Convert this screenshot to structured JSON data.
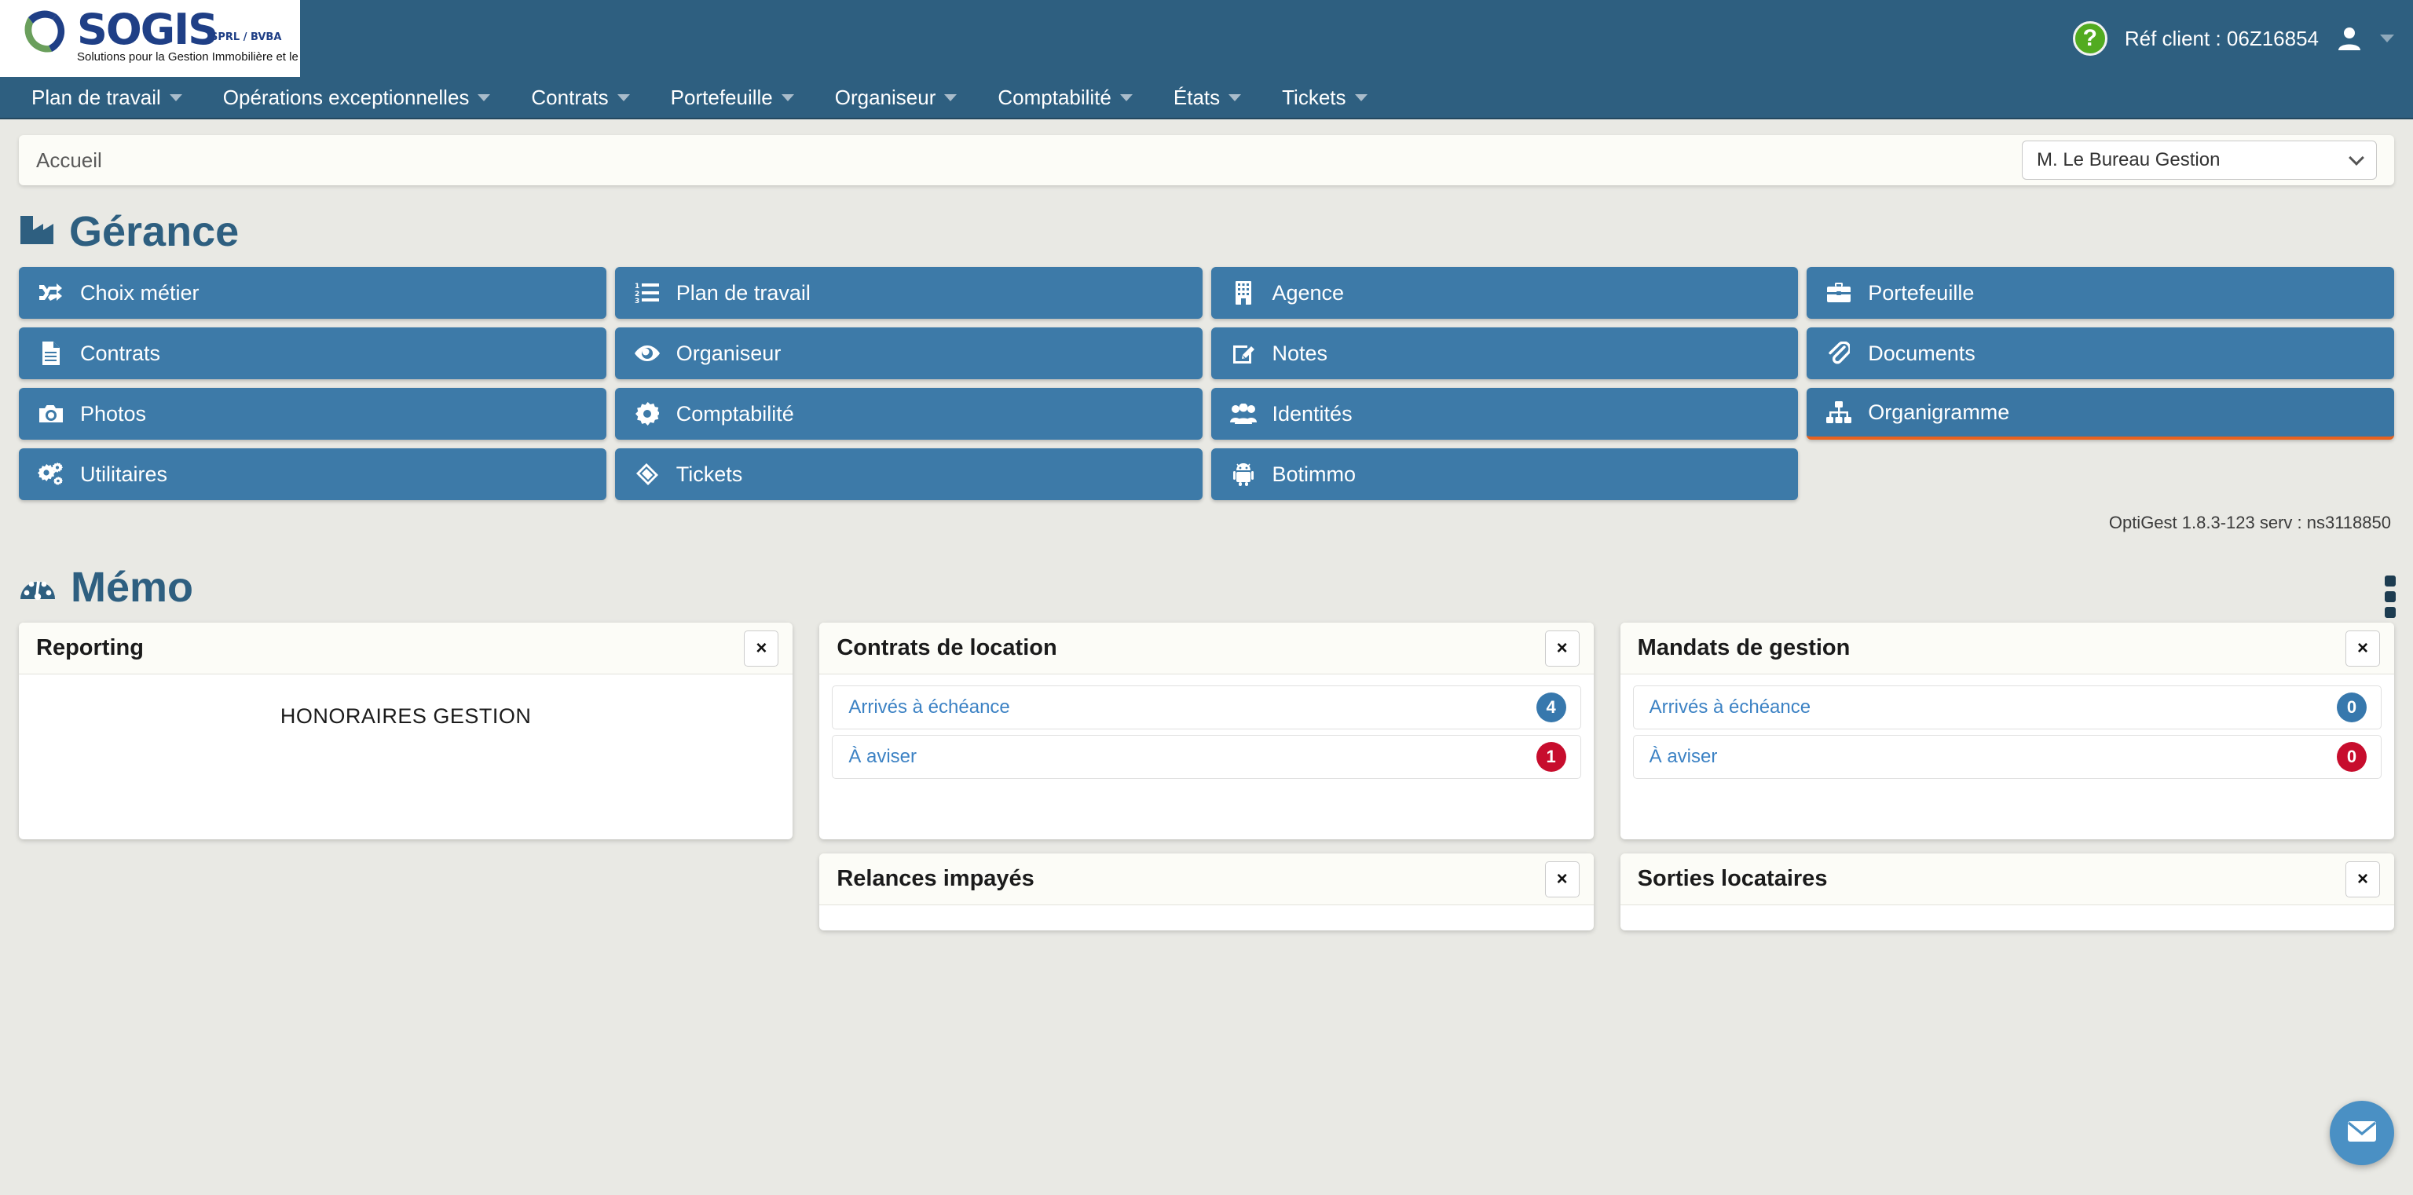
{
  "brand": {
    "name": "SOGIS",
    "legal_form": "SPRL / BVBA",
    "tagline": "Solutions pour la Gestion Immobilière et le Syndic",
    "primary_color": "#2e5f80",
    "tile_color": "#3d7aa8",
    "accent_orange": "#e8621f",
    "badge_blue": "#3778ad",
    "badge_red": "#c70d2d",
    "help_green": "#52ab20"
  },
  "topbar": {
    "help_icon": "question-mark-icon",
    "ref_client_label": "Réf client : 06Z16854",
    "user_icon": "user-avatar-icon",
    "user_caret_icon": "caret-down-icon"
  },
  "menu": {
    "items": [
      {
        "label": "Plan de travail",
        "caret": "caret-down-icon"
      },
      {
        "label": "Opérations exceptionnelles",
        "caret": "caret-down-icon"
      },
      {
        "label": "Contrats",
        "caret": "caret-down-icon"
      },
      {
        "label": "Portefeuille",
        "caret": "caret-down-icon"
      },
      {
        "label": "Organiseur",
        "caret": "caret-down-icon"
      },
      {
        "label": "Comptabilité",
        "caret": "caret-down-icon"
      },
      {
        "label": "États",
        "caret": "caret-down-icon"
      },
      {
        "label": "Tickets",
        "caret": "caret-down-icon"
      }
    ]
  },
  "breadcrumb": {
    "current": "Accueil",
    "context_select": {
      "value": "M. Le Bureau Gestion",
      "chevron": "chevron-down-icon"
    }
  },
  "gerance": {
    "icon": "factory-icon",
    "title": "Gérance",
    "tiles": [
      {
        "label": "Choix métier",
        "icon": "shuffle-icon",
        "active": false
      },
      {
        "label": "Plan de travail",
        "icon": "ordered-list-icon",
        "active": false
      },
      {
        "label": "Agence",
        "icon": "building-icon",
        "active": false
      },
      {
        "label": "Portefeuille",
        "icon": "briefcase-icon",
        "active": false
      },
      {
        "label": "Contrats",
        "icon": "document-icon",
        "active": false
      },
      {
        "label": "Organiseur",
        "icon": "eye-icon",
        "active": false
      },
      {
        "label": "Notes",
        "icon": "pencil-square-icon",
        "active": false
      },
      {
        "label": "Documents",
        "icon": "paperclip-icon",
        "active": false
      },
      {
        "label": "Photos",
        "icon": "camera-icon",
        "active": false
      },
      {
        "label": "Comptabilité",
        "icon": "gear-icon",
        "active": false
      },
      {
        "label": "Identités",
        "icon": "users-icon",
        "active": false
      },
      {
        "label": "Organigramme",
        "icon": "sitemap-icon",
        "active": true
      },
      {
        "label": "Utilitaires",
        "icon": "gears-icon",
        "active": false
      },
      {
        "label": "Tickets",
        "icon": "tag-icon",
        "active": false
      },
      {
        "label": "Botimmo",
        "icon": "android-robot-icon",
        "active": false
      }
    ]
  },
  "version_line": "OptiGest 1.8.3-123 serv : ns3118850",
  "memo": {
    "icon": "dashboard-gauge-icon",
    "title": "Mémo",
    "kebab_icon": "more-vertical-icon",
    "cards": [
      {
        "title": "Reporting",
        "close_label": "×",
        "type": "report",
        "report_text": "HONORAIRES GESTION",
        "rows": []
      },
      {
        "title": "Contrats de location",
        "close_label": "×",
        "type": "list",
        "rows": [
          {
            "label": "Arrivés à échéance",
            "count": "4",
            "tone": "blue"
          },
          {
            "label": "À aviser",
            "count": "1",
            "tone": "red"
          }
        ]
      },
      {
        "title": "Mandats de gestion",
        "close_label": "×",
        "type": "list",
        "rows": [
          {
            "label": "Arrivés à échéance",
            "count": "0",
            "tone": "blue"
          },
          {
            "label": "À aviser",
            "count": "0",
            "tone": "red"
          }
        ]
      },
      {
        "title": "Relances impayés",
        "close_label": "×",
        "type": "list",
        "rows": []
      },
      {
        "title": "Sorties locataires",
        "close_label": "×",
        "type": "list",
        "rows": []
      }
    ]
  },
  "fab": {
    "icon": "envelope-icon"
  }
}
